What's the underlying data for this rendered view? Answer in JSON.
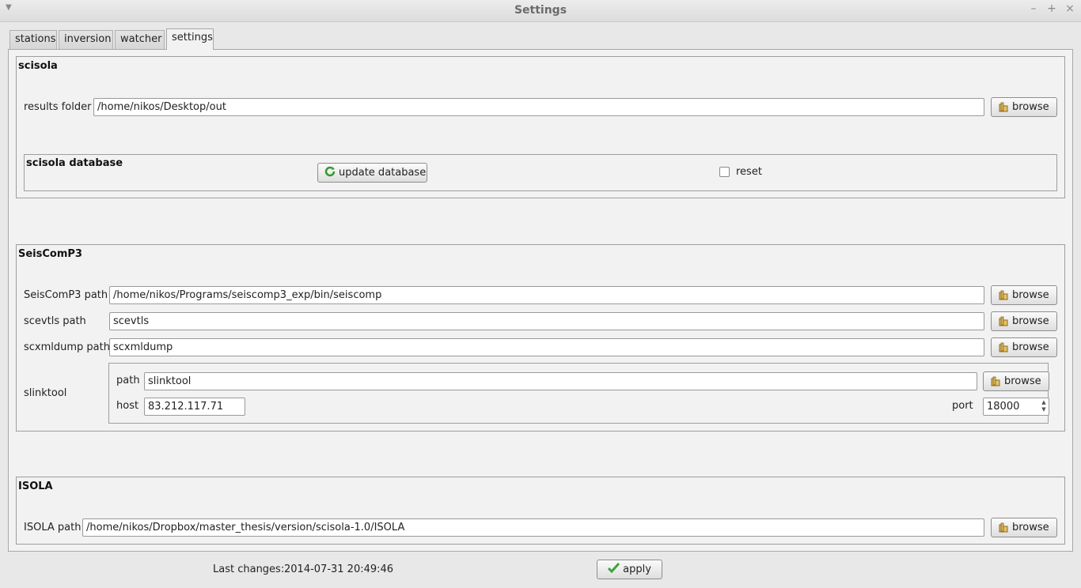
{
  "window": {
    "title": "Settings"
  },
  "tabs": [
    {
      "label": "stations"
    },
    {
      "label": "inversion"
    },
    {
      "label": "watcher"
    },
    {
      "label": "settings"
    }
  ],
  "scisola": {
    "title": "scisola",
    "results_folder_label": "results folder",
    "results_folder_value": "/home/nikos/Desktop/out",
    "browse_label": "browse",
    "database": {
      "title": "scisola database",
      "update_label": "update database",
      "reset_label": "reset"
    }
  },
  "seiscomp": {
    "title": "SeisComP3",
    "path_label": "SeisComP3 path",
    "path_value": "/home/nikos/Programs/seiscomp3_exp/bin/seiscomp",
    "scevtls_label": "scevtls path",
    "scevtls_value": "scevtls",
    "scxmldump_label": "scxmldump path",
    "scxmldump_value": "scxmldump",
    "browse_label": "browse",
    "slinktool": {
      "label": "slinktool",
      "path_label": "path",
      "path_value": "slinktool",
      "host_label": "host",
      "host_value": "83.212.117.71",
      "port_label": "port",
      "port_value": "18000",
      "browse_label": "browse"
    }
  },
  "isola": {
    "title": "ISOLA",
    "path_label": "ISOLA path",
    "path_value": "/home/nikos/Dropbox/master_thesis/version/scisola-1.0/ISOLA",
    "browse_label": "browse"
  },
  "footer": {
    "last_changes_label": "Last changes:",
    "last_changes_value": "2014-07-31 20:49:46",
    "apply_label": "apply"
  },
  "colors": {
    "refresh_icon": "#2e9a2e",
    "check_icon": "#3aa53a",
    "folder_icon": "#c9a24a"
  }
}
